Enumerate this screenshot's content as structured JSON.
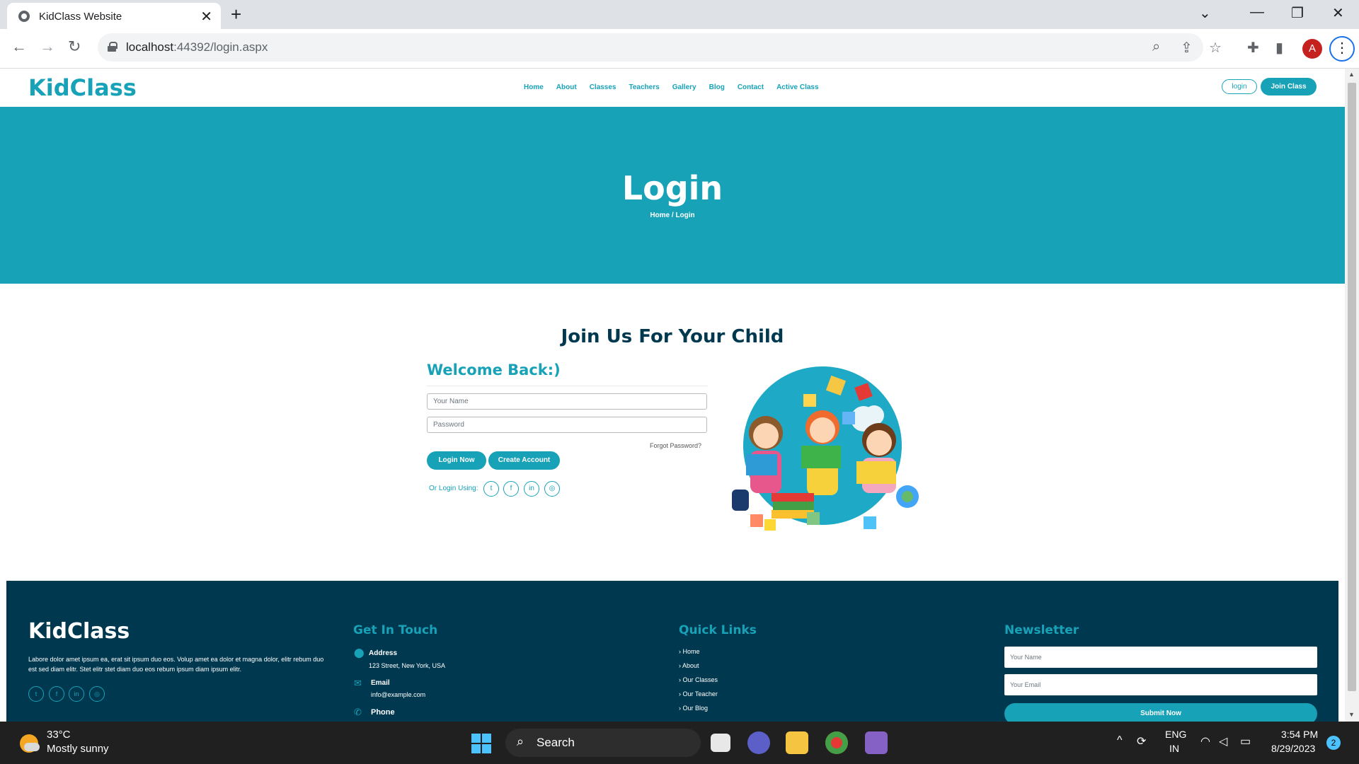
{
  "browser": {
    "tab_title": "KidClass Website",
    "url_host": "localhost",
    "url_rest": ":44392/login.aspx"
  },
  "nav": {
    "logo": "KidClass",
    "items": [
      "Home",
      "About",
      "Classes",
      "Teachers",
      "Gallery",
      "Blog",
      "Contact",
      "Active Class"
    ],
    "login_label": "login",
    "join_label": "Join Class"
  },
  "hero": {
    "title": "Login",
    "breadcrumb_home": "Home",
    "breadcrumb_sep": "/",
    "breadcrumb_current": "Login"
  },
  "main": {
    "section_title": "Join Us For Your Child",
    "welcome": "Welcome Back:)",
    "name_placeholder": "Your Name",
    "password_placeholder": "Password",
    "forgot": "Forgot Password?",
    "login_btn": "Login Now",
    "create_btn": "Create Account",
    "or_login": "Or Login Using:",
    "social_icons": [
      "twitter-icon",
      "facebook-icon",
      "linkedin-icon",
      "instagram-icon"
    ]
  },
  "footer": {
    "logo": "KidClass",
    "about_text": "Labore dolor amet ipsum ea, erat sit ipsum duo eos. Volup amet ea dolor et magna dolor, elitr rebum duo est sed diam elitr. Stet elitr stet diam duo eos rebum ipsum diam ipsum elitr.",
    "contact_heading": "Get In Touch",
    "address_label": "Address",
    "address_value": "123 Street, New York, USA",
    "email_label": "Email",
    "email_value": "info@example.com",
    "phone_label": "Phone",
    "quick_heading": "Quick Links",
    "quick_links": [
      "Home",
      "About",
      "Our Classes",
      "Our Teacher",
      "Our Blog"
    ],
    "newsletter_heading": "Newsletter",
    "nl_name_placeholder": "Your Name",
    "nl_email_placeholder": "Your Email",
    "nl_submit": "Submit Now"
  },
  "taskbar": {
    "temperature": "33°C",
    "weather": "Mostly sunny",
    "search": "Search",
    "lang": "ENG",
    "region": "IN",
    "time": "3:54 PM",
    "date": "8/29/2023",
    "notifications": "2"
  },
  "colors": {
    "brand": "#17a2b8",
    "navy": "#00394f"
  }
}
